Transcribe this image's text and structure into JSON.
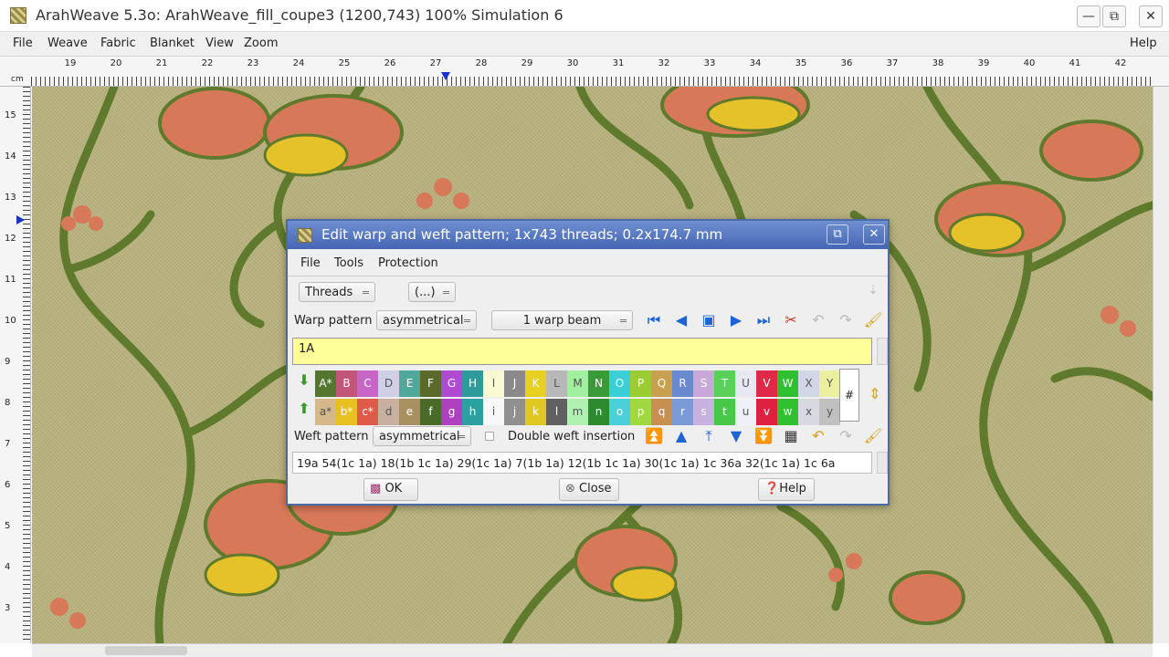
{
  "window": {
    "title": "ArahWeave 5.3o: ArahWeave_fill_coupe3 (1200,743) 100% Simulation 6",
    "minimize": "—",
    "maximize": "⧉",
    "close": "✕"
  },
  "menubar": {
    "items": [
      "File",
      "Weave",
      "Fabric",
      "Blanket",
      "View",
      "Zoom"
    ],
    "help": "Help"
  },
  "ruler": {
    "unit": "cm",
    "horizontal_ticks": [
      "19",
      "20",
      "21",
      "22",
      "23",
      "24",
      "25",
      "26",
      "27",
      "28",
      "29",
      "30",
      "31",
      "32",
      "33",
      "34",
      "35",
      "36",
      "37",
      "38",
      "39",
      "40",
      "41",
      "42"
    ],
    "vertical_ticks": [
      "15",
      "14",
      "13",
      "12",
      "11",
      "10",
      "9",
      "8",
      "7",
      "6",
      "5",
      "4",
      "3"
    ]
  },
  "dialog": {
    "title": "Edit warp and weft pattern; 1x743 threads; 0.2x174.7 mm",
    "menu": [
      "File",
      "Tools",
      "Protection"
    ],
    "threads_combo": "Threads",
    "ellipsis_combo": "(...)",
    "warp_pattern_label": "Warp pattern",
    "warp_pattern_value": "asymmetrical",
    "warp_beam_value": "1 warp beam",
    "warp_field_value": "1A",
    "weft_pattern_label": "Weft pattern",
    "weft_pattern_value": "asymmetrical",
    "double_weft_label": "Double weft insertion",
    "weft_field_value": "19a 54(1c 1a) 18(1b 1c 1a) 29(1c 1a) 7(1b 1a) 12(1b 1c 1a) 30(1c 1a) 1c 36a 32(1c 1a) 1c 6a",
    "hash_label": "#",
    "ok_label": "OK",
    "close_label": "Close",
    "help_label": "Help",
    "palette_upper": [
      {
        "label": "A*",
        "color": "#55762f"
      },
      {
        "label": "B",
        "color": "#c2567a"
      },
      {
        "label": "C",
        "color": "#c866c8"
      },
      {
        "label": "D",
        "color": "#cfd0e6"
      },
      {
        "label": "E",
        "color": "#4fa89a"
      },
      {
        "label": "F",
        "color": "#5a6a2a"
      },
      {
        "label": "G",
        "color": "#b04ad0"
      },
      {
        "label": "H",
        "color": "#2e9a9a"
      },
      {
        "label": "I",
        "color": "#fafad2"
      },
      {
        "label": "J",
        "color": "#8a8a8a"
      },
      {
        "label": "K",
        "color": "#e8d020"
      },
      {
        "label": "L",
        "color": "#b8b8b8"
      },
      {
        "label": "M",
        "color": "#a0f0a0"
      },
      {
        "label": "N",
        "color": "#3a9a3a"
      },
      {
        "label": "O",
        "color": "#3acfd6"
      },
      {
        "label": "P",
        "color": "#9acd32"
      },
      {
        "label": "Q",
        "color": "#c8a050"
      },
      {
        "label": "R",
        "color": "#6a8ad0"
      },
      {
        "label": "S",
        "color": "#c8a8d8"
      },
      {
        "label": "T",
        "color": "#5ad05a"
      },
      {
        "label": "U",
        "color": "#e8e8f4"
      },
      {
        "label": "V",
        "color": "#e02848"
      },
      {
        "label": "W",
        "color": "#2ec02e"
      },
      {
        "label": "X",
        "color": "#d0d8e8"
      },
      {
        "label": "Y",
        "color": "#eaf0a0"
      }
    ],
    "palette_lower": [
      {
        "label": "a*",
        "color": "#d6b98a"
      },
      {
        "label": "b*",
        "color": "#e8c020"
      },
      {
        "label": "c*",
        "color": "#e05a4a"
      },
      {
        "label": "d",
        "color": "#c8b0a0"
      },
      {
        "label": "e",
        "color": "#a89060"
      },
      {
        "label": "f",
        "color": "#4a6a2a"
      },
      {
        "label": "g",
        "color": "#b040c0"
      },
      {
        "label": "h",
        "color": "#2aa0a0"
      },
      {
        "label": "i",
        "color": "#f8f8f8"
      },
      {
        "label": "j",
        "color": "#909090"
      },
      {
        "label": "k",
        "color": "#e0c820"
      },
      {
        "label": "l",
        "color": "#606060"
      },
      {
        "label": "m",
        "color": "#b0f0b0"
      },
      {
        "label": "n",
        "color": "#2e8a2e"
      },
      {
        "label": "o",
        "color": "#4ad0d8"
      },
      {
        "label": "p",
        "color": "#a0d840"
      },
      {
        "label": "q",
        "color": "#c89050"
      },
      {
        "label": "r",
        "color": "#7a9ad8"
      },
      {
        "label": "s",
        "color": "#c8b0e0"
      },
      {
        "label": "t",
        "color": "#48c848"
      },
      {
        "label": "u",
        "color": "#f0f0f8"
      },
      {
        "label": "v",
        "color": "#e02040"
      },
      {
        "label": "w",
        "color": "#30c030"
      },
      {
        "label": "x",
        "color": "#d8d8e0"
      },
      {
        "label": "y",
        "color": "#c0c0c0"
      }
    ]
  }
}
